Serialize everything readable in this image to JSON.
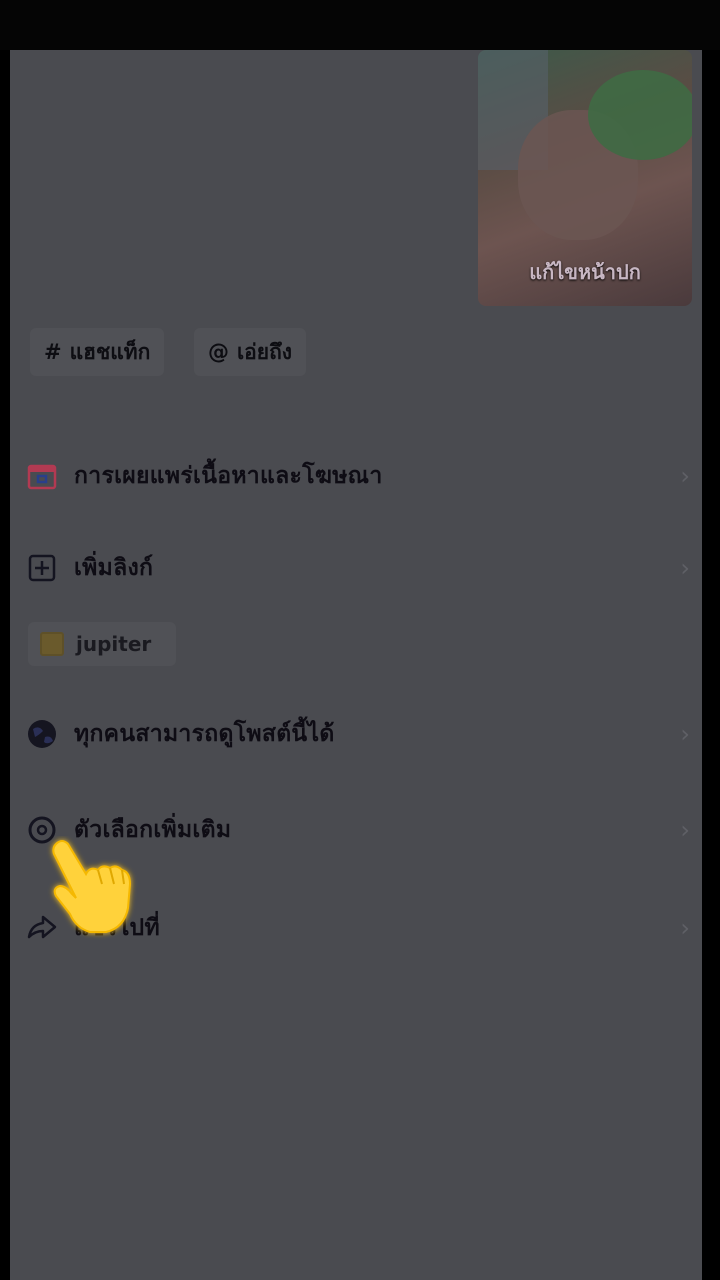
{
  "cover": {
    "edit_label": "แก้ไขหน้าปก"
  },
  "chips": [
    {
      "symbol": "#",
      "label": "แฮชแท็ก"
    },
    {
      "symbol": "@",
      "label": "เอ่ยถึง"
    }
  ],
  "menu": [
    {
      "label": "การเผยแพร่เนื้อหาและโฆษณา",
      "icon": "promotion-icon"
    },
    {
      "label": "เพิ่มลิงก์",
      "icon": "add-link-icon"
    },
    {
      "label": "ทุกคนสามารถดูโพสต์นี้ได้",
      "icon": "globe-icon"
    },
    {
      "label": "ตัวเลือกเพิ่มเติม",
      "icon": "settings-icon"
    },
    {
      "label": "แชร์ไปที่",
      "icon": "share-icon"
    }
  ],
  "link_chip": {
    "label": "jupiter"
  },
  "chevron": "›"
}
